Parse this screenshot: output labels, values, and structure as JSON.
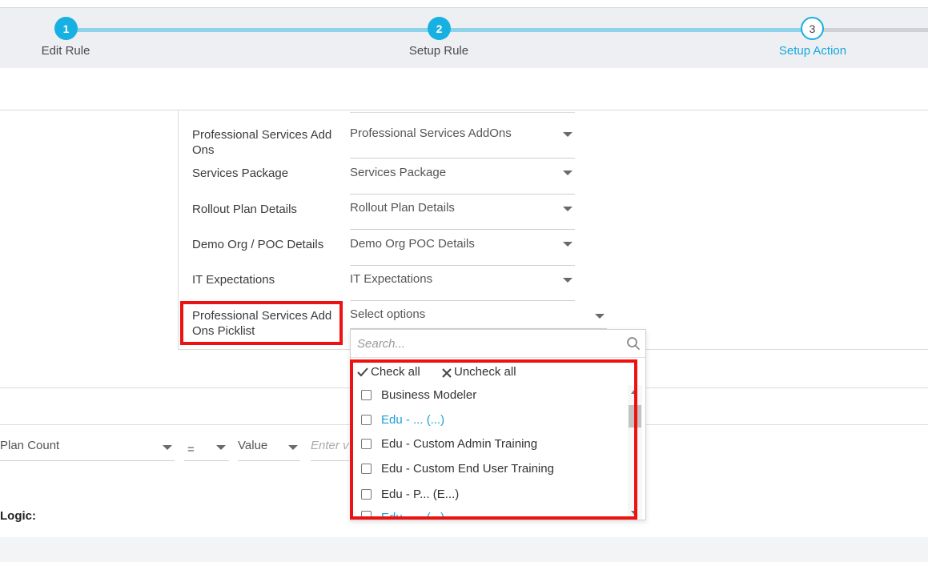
{
  "stepper": {
    "steps": [
      {
        "number": "1",
        "label": "Edit Rule",
        "state": "done"
      },
      {
        "number": "2",
        "label": "Setup Rule",
        "state": "done"
      },
      {
        "number": "3",
        "label": "Setup Action",
        "state": "current"
      }
    ],
    "accent_color": "#16b0e2"
  },
  "fields": [
    {
      "label": "Professional Services Add Ons",
      "value": "Professional Services AddOns"
    },
    {
      "label": "Services Package",
      "value": "Services Package"
    },
    {
      "label": "Rollout Plan Details",
      "value": "Rollout Plan Details"
    },
    {
      "label": "Demo Org / POC Details",
      "value": "Demo Org POC Details"
    },
    {
      "label": "IT Expectations",
      "value": "IT Expectations"
    },
    {
      "label": "Professional Services Add Ons Picklist",
      "value": "Select options"
    }
  ],
  "dropdown": {
    "search_placeholder": "Search...",
    "check_all": "Check all",
    "uncheck_all": "Uncheck all",
    "options": [
      "Business Modeler",
      "Edu - ... (...)",
      "Edu - Custom Admin Training",
      "Edu - Custom End User Training",
      "Edu - P... (E...)",
      "Edu - ... (...)"
    ]
  },
  "condition": {
    "field": "Plan Count",
    "operator": "=",
    "value_type": "Value",
    "value_placeholder": "Enter v"
  },
  "logic_label": "Logic:",
  "highlight_color": "#ee1111"
}
